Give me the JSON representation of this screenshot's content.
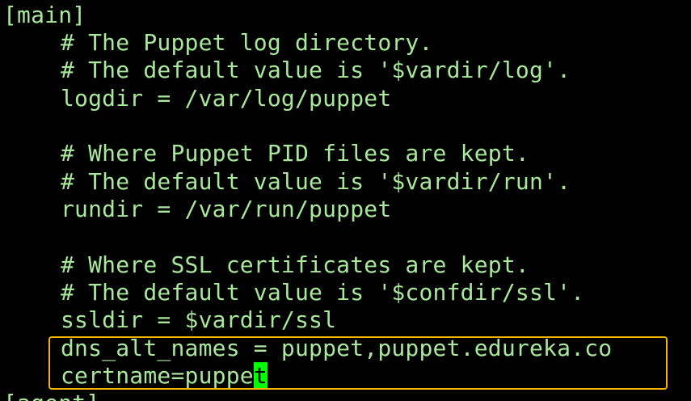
{
  "terminal": {
    "lines": [
      "[main]",
      "# The Puppet log directory.",
      "# The default value is '$vardir/log'.",
      "logdir = /var/log/puppet",
      "",
      "# Where Puppet PID files are kept.",
      "# The default value is '$vardir/run'.",
      "rundir = /var/run/puppet",
      "",
      "# Where SSL certificates are kept.",
      "# The default value is '$confdir/ssl'.",
      "ssldir = $vardir/ssl",
      "dns_alt_names = puppet,puppet.edureka.co",
      "certname=puppe",
      "[agent]"
    ],
    "cursor_char": "t"
  },
  "colors": {
    "text": "#a8e89a",
    "cursor": "#00ff00",
    "highlight_border": "#f4b400",
    "background": "#000000"
  }
}
